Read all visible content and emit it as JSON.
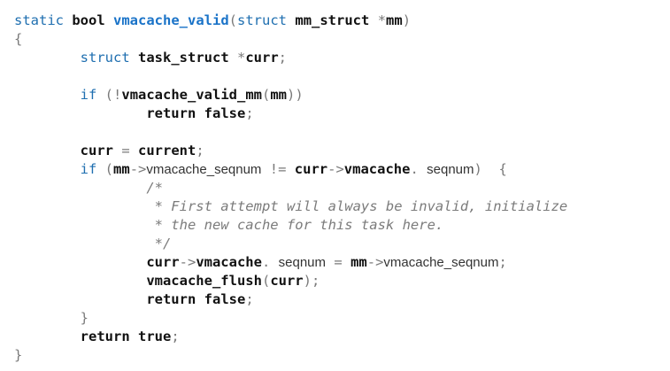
{
  "colors": {
    "keyword": "#1f6fb0",
    "function_name": "#1a73c8",
    "identifier": "#111111",
    "punctuation": "#7a7a7a",
    "comment": "#7b7b7b",
    "background": "#ffffff"
  },
  "code": {
    "l1": {
      "kw_static": "static",
      "sp1": " ",
      "t_bool": "bool",
      "sp2": " ",
      "fn": "vmacache_valid",
      "lp": "(",
      "kw_struct": "struct",
      "sp3": " ",
      "t_mm_struct": "mm_struct",
      "sp4": " ",
      "star": "*",
      "p_mm": "mm",
      "rp": ")"
    },
    "l2": {
      "lbrace": "{"
    },
    "l3": {
      "indent": "        ",
      "kw_struct": "struct",
      "sp1": " ",
      "t_task_struct": "task_struct",
      "sp2": " ",
      "star": "*",
      "v_curr": "curr",
      "semi": ";"
    },
    "l5": {
      "indent": "        ",
      "kw_if": "if",
      "sp1": " ",
      "lp": "(",
      "not": "!",
      "fn": "vmacache_valid_mm",
      "lp2": "(",
      "arg": "mm",
      "rp2": ")",
      "rp": ")"
    },
    "l6": {
      "indent": "                ",
      "kw_return": "return",
      "sp1": " ",
      "v_false": "false",
      "semi": ";"
    },
    "l8": {
      "indent": "        ",
      "v_curr": "curr",
      "sp1": " ",
      "eq": "=",
      "sp2": " ",
      "v_current": "current",
      "semi": ";"
    },
    "l9": {
      "indent": "        ",
      "kw_if": "if",
      "sp1": " ",
      "lp": "(",
      "v_mm": "mm",
      "arrow": "->",
      "f_seqnum": "vmacache_seqnum",
      "sp2": " ",
      "neq": "!=",
      "sp3": " ",
      "v_curr": "curr",
      "arrow2": "->",
      "f_vmacache": "vmacache",
      "dot": ".",
      "sp4": " ",
      "f_seqnum2": "seqnum",
      "rp": ")",
      "sp5": "  ",
      "lbrace": "{"
    },
    "l10": {
      "indent": "                ",
      "text": "/*"
    },
    "l11": {
      "indent": "                 ",
      "text": "* First attempt will always be invalid, initialize"
    },
    "l12": {
      "indent": "                 ",
      "text": "* the new cache for this task here."
    },
    "l13": {
      "indent": "                 ",
      "text": "*/"
    },
    "l14": {
      "indent": "                ",
      "v_curr": "curr",
      "arrow": "->",
      "f_vmacache": "vmacache",
      "dot": ".",
      "sp1": " ",
      "f_seqnum": "seqnum",
      "sp2": " ",
      "eq": "=",
      "sp3": " ",
      "v_mm": "mm",
      "arrow2": "->",
      "f_seqnum2": "vmacache_seqnum",
      "semi": ";"
    },
    "l15": {
      "indent": "                ",
      "fn": "vmacache_flush",
      "lp": "(",
      "arg": "curr",
      "rp": ")",
      "semi": ";"
    },
    "l16": {
      "indent": "                ",
      "kw_return": "return",
      "sp1": " ",
      "v_false": "false",
      "semi": ";"
    },
    "l17": {
      "indent": "        ",
      "rbrace": "}"
    },
    "l18": {
      "indent": "        ",
      "kw_return": "return",
      "sp1": " ",
      "v_true": "true",
      "semi": ";"
    },
    "l19": {
      "rbrace": "}"
    }
  }
}
